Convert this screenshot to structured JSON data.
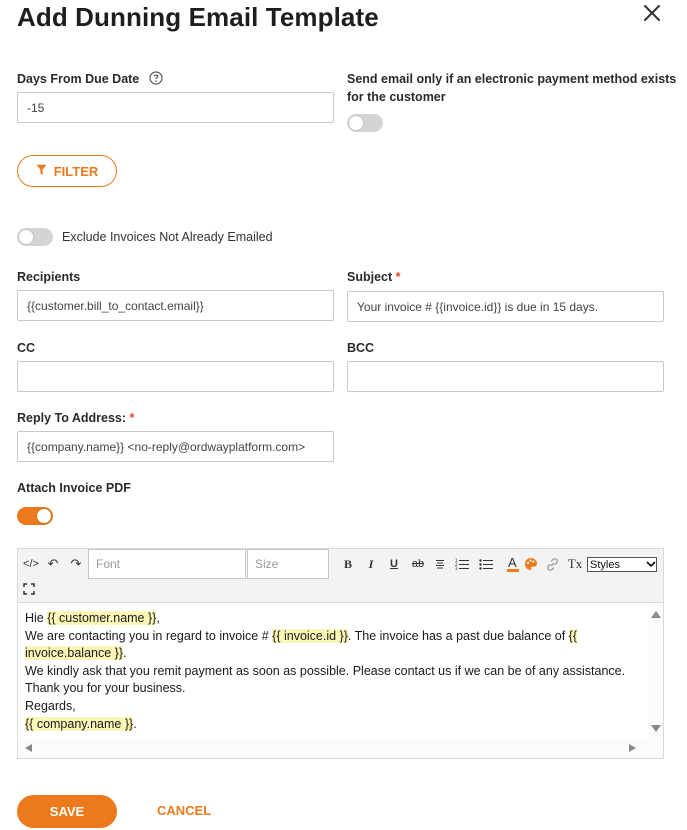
{
  "modal": {
    "title": "Add Dunning Email Template"
  },
  "days_from_due": {
    "label": "Days From Due Date",
    "value": "-15"
  },
  "electronic_payment": {
    "label_line1": "Send email only if an electronic payment method exists",
    "label_line2": "for the customer",
    "enabled": false
  },
  "filter_button": {
    "label": "FILTER"
  },
  "exclude_invoices": {
    "label": "Exclude Invoices Not Already Emailed",
    "enabled": false
  },
  "recipients": {
    "label": "Recipients",
    "value": "{{customer.bill_to_contact.email}}"
  },
  "subject": {
    "label": "Subject",
    "required_mark": "*",
    "value": "Your invoice # {{invoice.id}} is due in 15 days."
  },
  "cc": {
    "label": "CC",
    "value": ""
  },
  "bcc": {
    "label": "BCC",
    "value": ""
  },
  "reply_to": {
    "label": "Reply To Address:",
    "required_mark": "*",
    "value": "{{company.name}} <no-reply@ordwayplatform.com>"
  },
  "attach_pdf": {
    "label": "Attach Invoice PDF",
    "enabled": true
  },
  "editor": {
    "toolbar": {
      "source_label": "</>",
      "undo_label": "↶",
      "redo_label": "↷",
      "font_placeholder": "Font",
      "size_placeholder": "Size",
      "bold_label": "B",
      "italic_label": "I",
      "underline_label": "U",
      "strike_label": "ab",
      "clear_format_label": "Tx",
      "styles_label": "Styles"
    },
    "body": {
      "l1_prefix": "Hie ",
      "l1_var": "{{ customer.name }}",
      "l1_suffix": ",",
      "l2_prefix": "We are contacting you in regard to invoice # ",
      "l2_var1": "{{ invoice.id }}",
      "l2_mid": ". The invoice has a past due balance of ",
      "l2_var2a": "{{",
      "l3_var2b": "invoice.balance }}",
      "l3_suffix": ".",
      "l4": "We kindly ask that you remit payment as soon as possible. Please contact us if we can be of any assistance.",
      "l5": "Thank you for your business.",
      "l6": "Regards,",
      "l7_var": "{{ company.name }}",
      "l7_suffix": "."
    }
  },
  "actions": {
    "save_label": "SAVE",
    "cancel_label": "CANCEL"
  },
  "colors": {
    "accent": "#ec7a1c",
    "required": "#e8422f",
    "highlight": "#fcf7b6"
  },
  "icons": {
    "close": "close-icon",
    "help": "question-circle-icon",
    "filter": "funnel-icon"
  }
}
